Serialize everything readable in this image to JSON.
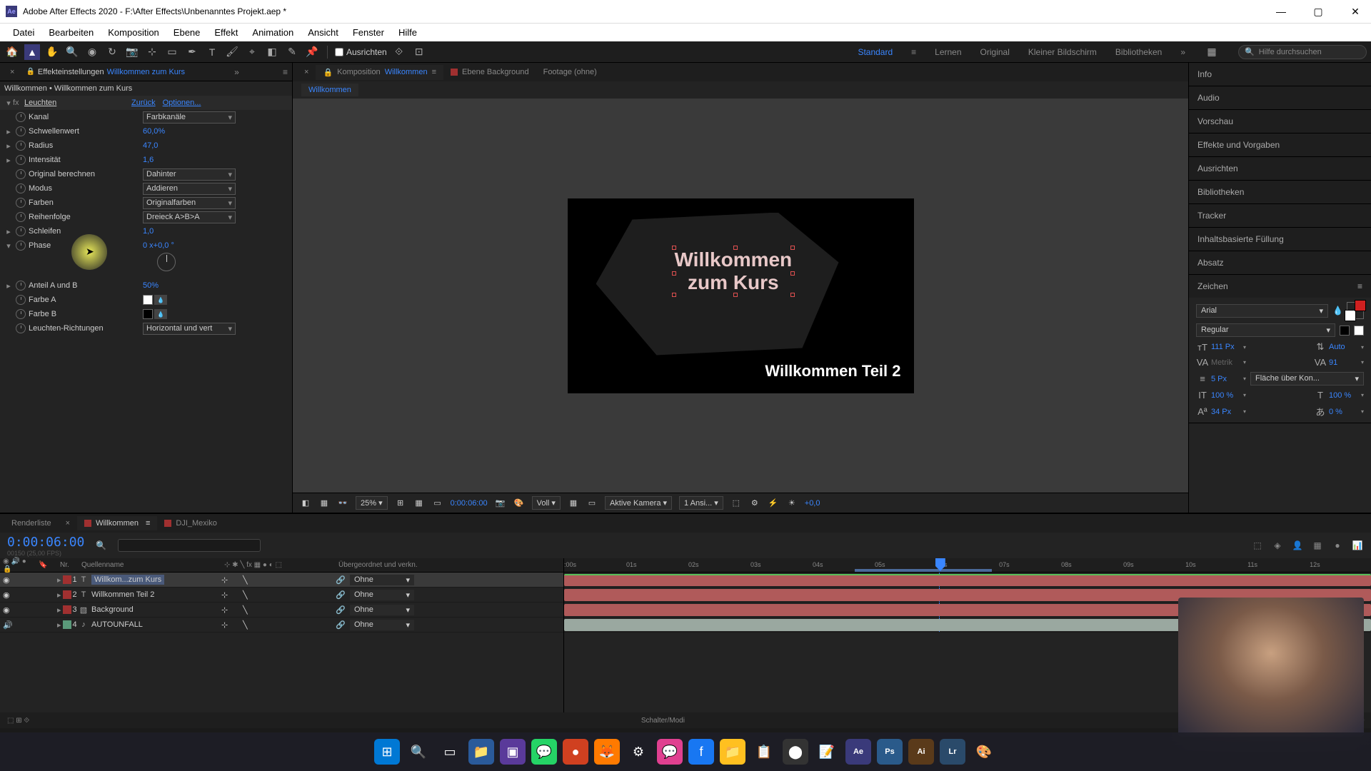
{
  "window": {
    "title": "Adobe After Effects 2020 - F:\\After Effects\\Unbenanntes Projekt.aep *"
  },
  "menu": [
    "Datei",
    "Bearbeiten",
    "Komposition",
    "Ebene",
    "Effekt",
    "Animation",
    "Ansicht",
    "Fenster",
    "Hilfe"
  ],
  "toolbar": {
    "align_label": "Ausrichten",
    "workspaces": [
      "Standard",
      "Lernen",
      "Original",
      "Kleiner Bildschirm",
      "Bibliotheken"
    ],
    "search_placeholder": "Hilfe durchsuchen"
  },
  "effect_panel": {
    "tab_label": "Effekteinstellungen",
    "comp_name": "Willkommen zum Kurs",
    "breadcrumb": "Willkommen • Willkommen zum Kurs",
    "effect_name": "Leuchten",
    "reset": "Zurück",
    "options": "Optionen...",
    "props": {
      "kanal": {
        "label": "Kanal",
        "value": "Farbkanäle"
      },
      "schwellenwert": {
        "label": "Schwellenwert",
        "value": "60,0%"
      },
      "radius": {
        "label": "Radius",
        "value": "47,0"
      },
      "intensitat": {
        "label": "Intensität",
        "value": "1,6"
      },
      "original": {
        "label": "Original berechnen",
        "value": "Dahinter"
      },
      "modus": {
        "label": "Modus",
        "value": "Addieren"
      },
      "farben": {
        "label": "Farben",
        "value": "Originalfarben"
      },
      "reihenfolge": {
        "label": "Reihenfolge",
        "value": "Dreieck A>B>A"
      },
      "schleifen": {
        "label": "Schleifen",
        "value": "1,0"
      },
      "phase": {
        "label": "Phase",
        "value": "0 x+0,0 °"
      },
      "anteil": {
        "label": "Anteil A und B",
        "value": "50%"
      },
      "farbe_a": {
        "label": "Farbe A"
      },
      "farbe_b": {
        "label": "Farbe B"
      },
      "richtungen": {
        "label": "Leuchten-Richtungen",
        "value": "Horizontal und vert"
      }
    }
  },
  "comp_panel": {
    "tab1_prefix": "Komposition",
    "tab1_name": "Willkommen",
    "tab2": "Ebene Background",
    "tab3": "Footage (ohne)",
    "breadcrumb": "Willkommen",
    "title_line1": "Willkommen",
    "title_line2": "zum Kurs",
    "subtitle": "Willkommen Teil 2"
  },
  "viewer_bar": {
    "zoom": "25%",
    "timecode": "0:00:06:00",
    "res": "Voll",
    "camera": "Aktive Kamera",
    "views": "1 Ansi...",
    "exposure": "+0,0"
  },
  "side_panels": {
    "info": "Info",
    "audio": "Audio",
    "vorschau": "Vorschau",
    "effekte": "Effekte und Vorgaben",
    "ausrichten": "Ausrichten",
    "bibliotheken": "Bibliotheken",
    "tracker": "Tracker",
    "fullung": "Inhaltsbasierte Füllung",
    "absatz": "Absatz",
    "zeichen": "Zeichen"
  },
  "character": {
    "font": "Arial",
    "style": "Regular",
    "size": "111 Px",
    "leading": "Auto",
    "kerning": "Metrik",
    "tracking": "91",
    "stroke": "5 Px",
    "stroke_opt": "Fläche über Kon...",
    "vscale": "100 %",
    "hscale": "100 %",
    "baseline": "34 Px",
    "tsume": "0 %"
  },
  "timeline": {
    "tabs": [
      "Renderliste",
      "Willkommen",
      "DJI_Mexiko"
    ],
    "timecode": "0:00:06:00",
    "fps": "00150 (25,00 FPS)",
    "cols": {
      "nr": "Nr.",
      "name": "Quellenname",
      "parent": "Übergeordnet und verkn."
    },
    "parent_none": "Ohne",
    "layers": [
      {
        "nr": "1",
        "name": "Willkom...zum Kurs",
        "type": "T",
        "color": "#a03030",
        "selected": true
      },
      {
        "nr": "2",
        "name": "Willkommen Teil 2",
        "type": "T",
        "color": "#a03030",
        "selected": false
      },
      {
        "nr": "3",
        "name": "Background",
        "type": "S",
        "color": "#a03030",
        "selected": false
      },
      {
        "nr": "4",
        "name": "AUTOUNFALL",
        "type": "A",
        "color": "#5a9a7a",
        "selected": false
      }
    ],
    "ruler": [
      ":00s",
      "01s",
      "02s",
      "03s",
      "04s",
      "05s",
      "06s",
      "07s",
      "08s",
      "09s",
      "10s",
      "11s",
      "12s"
    ],
    "footer": "Schalter/Modi"
  }
}
